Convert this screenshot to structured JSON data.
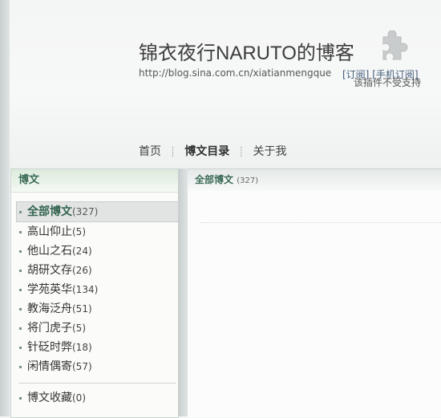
{
  "header": {
    "title": "锦衣夜行NARUTO的博客",
    "url": "http://blog.sina.com.cn/xiatianmengque",
    "subscribe_link": "[订阅]",
    "mobile_subscribe_link": "[手机订阅]",
    "plugin_notice": "该插件不受支持",
    "plugin_icon": "puzzle-piece-icon"
  },
  "nav": {
    "items": [
      {
        "label": "首页"
      },
      {
        "label": "博文目录"
      },
      {
        "label": "关于我"
      }
    ],
    "separator": "┊"
  },
  "sidebar": {
    "title": "博文",
    "categories": [
      {
        "label": "全部博文",
        "count": "(327)"
      },
      {
        "label": "高山仰止",
        "count": "(5)"
      },
      {
        "label": "他山之石",
        "count": "(24)"
      },
      {
        "label": "胡研文存",
        "count": "(26)"
      },
      {
        "label": "学苑英华",
        "count": "(134)"
      },
      {
        "label": "教海泛舟",
        "count": "(51)"
      },
      {
        "label": "将门虎子",
        "count": "(5)"
      },
      {
        "label": "针砭时弊",
        "count": "(18)"
      },
      {
        "label": "闲情偶寄",
        "count": "(57)"
      }
    ],
    "favorites": {
      "label": "博文收藏",
      "count": "(0)"
    }
  },
  "main": {
    "title": "全部博文",
    "count": "(327)"
  },
  "colors": {
    "accent_green": "#3a6a55",
    "link_blue": "#405a78"
  }
}
